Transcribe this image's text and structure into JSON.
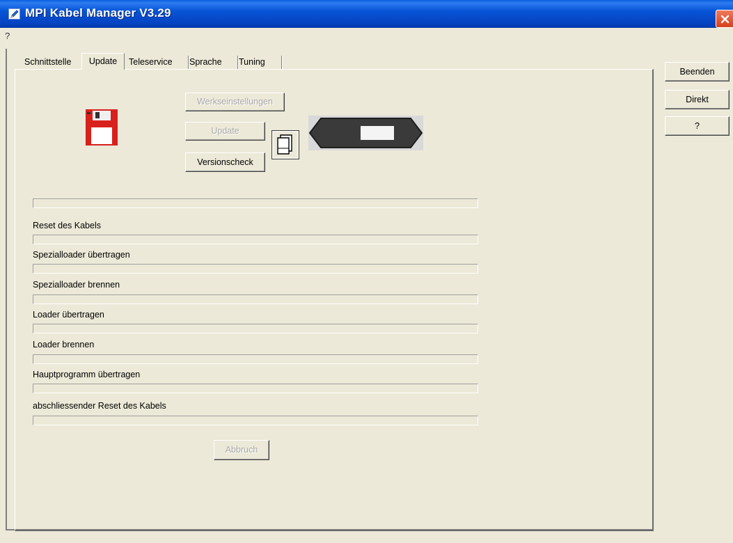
{
  "window": {
    "title": "MPI Kabel Manager V3.29"
  },
  "menu": {
    "help": "?"
  },
  "tabs": [
    {
      "label": "Schnittstelle",
      "active": false
    },
    {
      "label": "Update",
      "active": true
    },
    {
      "label": "Teleservice",
      "active": false
    },
    {
      "label": "Sprache",
      "active": false
    },
    {
      "label": "Tuning",
      "active": false
    }
  ],
  "update": {
    "factory_reset_label": "Werkseinstellungen",
    "update_label": "Update",
    "version_check_label": "Versionscheck",
    "cancel_label": "Abbruch",
    "overall_progress": 0,
    "steps": [
      {
        "label": "Reset des Kabels",
        "progress": 0
      },
      {
        "label": "Spezialloader übertragen",
        "progress": 0
      },
      {
        "label": "Spezialloader brennen",
        "progress": 0
      },
      {
        "label": "Loader übertragen",
        "progress": 0
      },
      {
        "label": "Loader brennen",
        "progress": 0
      },
      {
        "label": "Hauptprogramm übertragen",
        "progress": 0
      },
      {
        "label": "abschliessender Reset des Kabels",
        "progress": 0
      }
    ]
  },
  "side_buttons": {
    "exit_label": "Beenden",
    "direct_label": "Direkt",
    "help_label": "?"
  },
  "icons": {
    "app": "pencil-icon",
    "close": "close-icon",
    "floppy": "floppy-disk-icon",
    "folder": "folder-icon",
    "cable": "mpi-cable-icon"
  },
  "colors": {
    "titlebar": "#0653d7",
    "close": "#d5401c",
    "floppy": "#d8201c",
    "cable": "#3a3a3a"
  }
}
